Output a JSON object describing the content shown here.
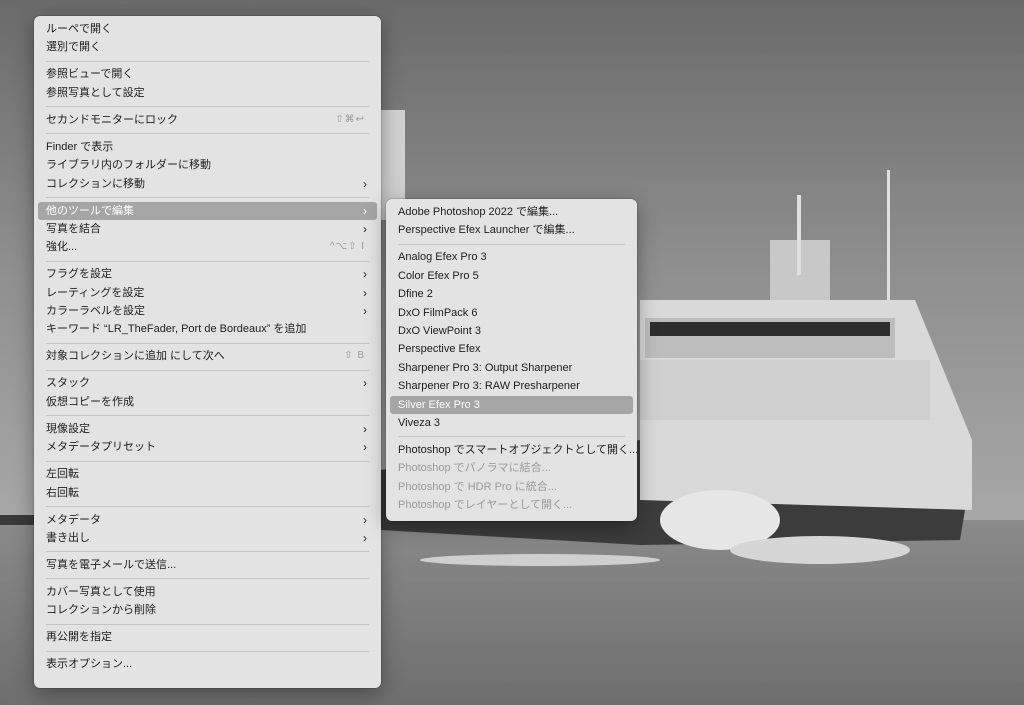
{
  "main_menu": {
    "groups": [
      [
        {
          "label": "ルーペで開く"
        },
        {
          "label": "選別で開く"
        }
      ],
      [
        {
          "label": "参照ビューで開く"
        },
        {
          "label": "参照写真として設定"
        }
      ],
      [
        {
          "label": "セカンドモニターにロック",
          "shortcut": "⇧⌘↩"
        }
      ],
      [
        {
          "label": "Finder で表示"
        },
        {
          "label": "ライブラリ内のフォルダーに移動"
        },
        {
          "label": "コレクションに移動",
          "submenu": true
        }
      ],
      [
        {
          "label": "他のツールで編集",
          "submenu": true,
          "highlighted": true
        },
        {
          "label": "写真を結合",
          "submenu": true
        },
        {
          "label": "強化...",
          "shortcut": "^⌥⇧ I"
        }
      ],
      [
        {
          "label": "フラグを設定",
          "submenu": true
        },
        {
          "label": "レーティングを設定",
          "submenu": true
        },
        {
          "label": "カラーラベルを設定",
          "submenu": true
        },
        {
          "label": "キーワード “LR_TheFader, Port de Bordeaux” を追加"
        }
      ],
      [
        {
          "label": "対象コレクションに追加 にして次へ",
          "shortcut": "⇧ B"
        }
      ],
      [
        {
          "label": "スタック",
          "submenu": true
        },
        {
          "label": "仮想コピーを作成"
        }
      ],
      [
        {
          "label": "現像設定",
          "submenu": true
        },
        {
          "label": "メタデータプリセット",
          "submenu": true
        }
      ],
      [
        {
          "label": "左回転"
        },
        {
          "label": "右回転"
        }
      ],
      [
        {
          "label": "メタデータ",
          "submenu": true
        },
        {
          "label": "書き出し",
          "submenu": true
        }
      ],
      [
        {
          "label": "写真を電子メールで送信..."
        }
      ],
      [
        {
          "label": "カバー写真として使用"
        },
        {
          "label": "コレクションから削除"
        }
      ],
      [
        {
          "label": "再公開を指定"
        }
      ],
      [
        {
          "label": "表示オプション..."
        }
      ]
    ]
  },
  "sub_menu": {
    "groups": [
      [
        {
          "label": "Adobe Photoshop 2022 で編集..."
        },
        {
          "label": "Perspective Efex Launcher で編集..."
        }
      ],
      [
        {
          "label": "Analog Efex Pro 3"
        },
        {
          "label": "Color Efex Pro 5"
        },
        {
          "label": "Dfine 2"
        },
        {
          "label": "DxO FilmPack 6"
        },
        {
          "label": "DxO ViewPoint 3"
        },
        {
          "label": "Perspective Efex"
        },
        {
          "label": "Sharpener Pro 3: Output Sharpener"
        },
        {
          "label": "Sharpener Pro 3: RAW Presharpener"
        },
        {
          "label": "Silver Efex Pro 3",
          "highlighted": true
        },
        {
          "label": "Viveza 3"
        }
      ],
      [
        {
          "label": "Photoshop でスマートオブジェクトとして開く..."
        },
        {
          "label": "Photoshop でパノラマに結合...",
          "disabled": true
        },
        {
          "label": "Photoshop で HDR Pro に統合...",
          "disabled": true
        },
        {
          "label": "Photoshop でレイヤーとして開く...",
          "disabled": true
        }
      ]
    ]
  },
  "icons": {
    "submenu_arrow": "chevron-right-icon"
  },
  "colors": {
    "menu_bg": "#e3e3e3",
    "highlight": "#a5a5a5",
    "separator": "#c4c4c4",
    "disabled_text": "#9a9a9a"
  }
}
